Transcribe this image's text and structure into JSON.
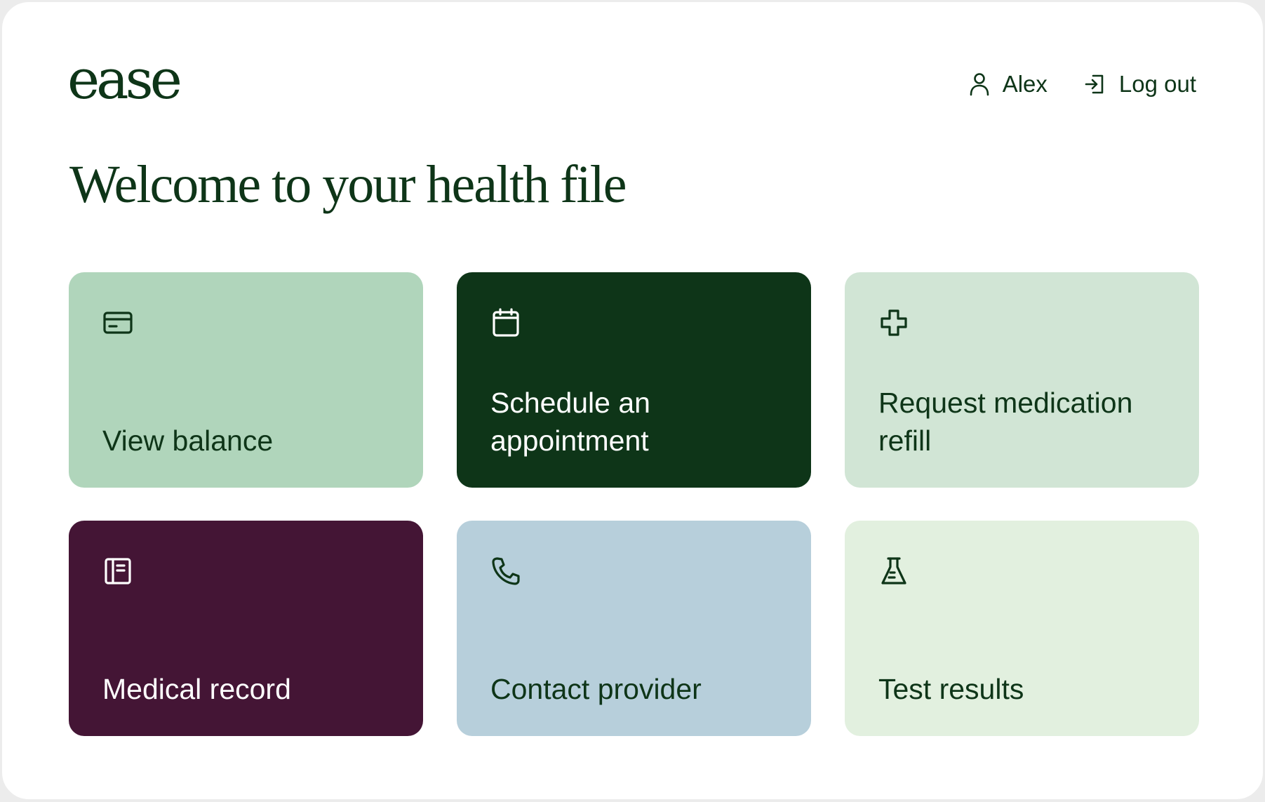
{
  "header": {
    "logo_text": "ease",
    "user_name": "Alex",
    "logout_label": "Log out"
  },
  "main": {
    "title": "Welcome to your health file",
    "tiles": [
      {
        "label": "View balance",
        "icon": "credit-card-icon",
        "bg": "#b0d5bb",
        "fg": "#0e3518"
      },
      {
        "label": "Schedule an appointment",
        "icon": "calendar-icon",
        "bg": "#0e3518",
        "fg": "#ffffff"
      },
      {
        "label": "Request medication refill",
        "icon": "medical-cross-icon",
        "bg": "#d1e5d5",
        "fg": "#0e3518"
      },
      {
        "label": "Medical record",
        "icon": "record-book-icon",
        "bg": "#441535",
        "fg": "#ffffff"
      },
      {
        "label": "Contact provider",
        "icon": "phone-icon",
        "bg": "#b7cfdb",
        "fg": "#0e3518"
      },
      {
        "label": "Test results",
        "icon": "flask-icon",
        "bg": "#e2f0df",
        "fg": "#0e3518"
      }
    ]
  },
  "colors": {
    "brand_dark_green": "#0e3518",
    "background": "#ffffff",
    "border": "#ececec"
  }
}
